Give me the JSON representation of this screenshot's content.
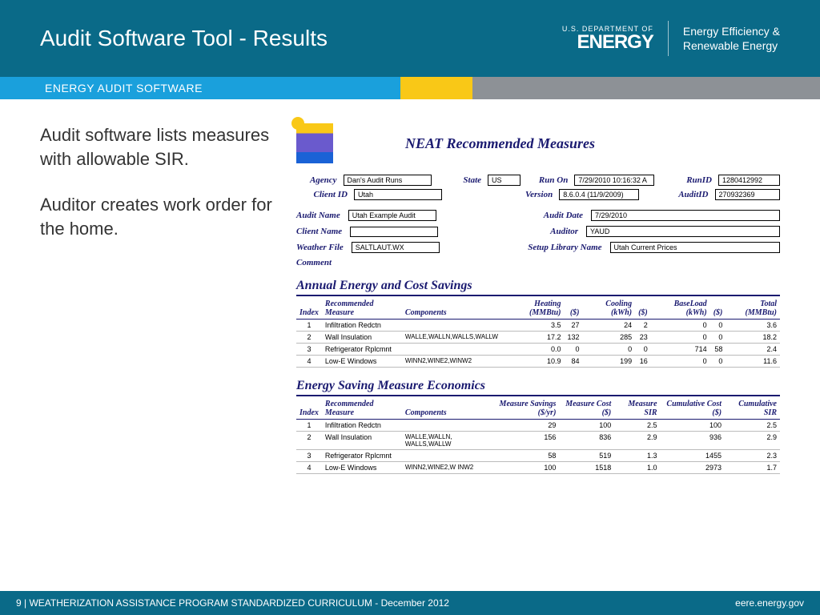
{
  "header": {
    "title": "Audit Software Tool - Results",
    "doe_small": "U.S. DEPARTMENT OF",
    "doe_big": "ENERGY",
    "eere_l1": "Energy Efficiency &",
    "eere_l2": "Renewable Energy"
  },
  "ribbon": {
    "text": "ENERGY AUDIT SOFTWARE"
  },
  "body": {
    "p1": "Audit software lists measures with allowable SIR.",
    "p2": "Auditor creates work order for the home."
  },
  "report": {
    "title": "NEAT Recommended Measures",
    "meta1": {
      "agency": "Dan's Audit Runs",
      "state": "US",
      "run_on": "7/29/2010 10:16:32 A",
      "runid": "1280412992",
      "client_id": "Utah",
      "version": "8.6.0.4 (11/9/2009)",
      "auditid": "270932369",
      "audit_name": "Utah Example Audit",
      "audit_date": "7/29/2010",
      "client_name": "",
      "auditor": "YAUD",
      "weather_file": "SALTLAUT.WX",
      "setup_lib": "Utah Current Prices",
      "comment": ""
    },
    "labels": {
      "agency": "Agency",
      "client_id": "Client ID",
      "state": "State",
      "run_on": "Run On",
      "runid": "RunID",
      "version": "Version",
      "auditid": "AuditID",
      "audit_name": "Audit Name",
      "audit_date": "Audit Date",
      "client_name": "Client Name",
      "auditor": "Auditor",
      "weather_file": "Weather File",
      "setup_lib": "Setup Library Name",
      "comment": "Comment"
    },
    "sec1": {
      "title": "Annual Energy and Cost Savings",
      "head": [
        "Index",
        "Recommended Measure",
        "Components",
        "Heating (MMBtu)",
        "($)",
        "Cooling (kWh)",
        "($)",
        "BaseLoad (kWh)",
        "($)",
        "Total (MMBtu)"
      ],
      "rows": [
        [
          "1",
          "Infiltration Redctn",
          "",
          "3.5",
          "27",
          "24",
          "2",
          "0",
          "0",
          "3.6"
        ],
        [
          "2",
          "Wall Insulation",
          "WALLE,WALLN,WALLS,WALLW",
          "17.2",
          "132",
          "285",
          "23",
          "0",
          "0",
          "18.2"
        ],
        [
          "3",
          "Refrigerator Rplcmnt",
          "",
          "0.0",
          "0",
          "0",
          "0",
          "714",
          "58",
          "2.4"
        ],
        [
          "4",
          "Low-E Windows",
          "WINN2,WINE2,WINW2",
          "10.9",
          "84",
          "199",
          "16",
          "0",
          "0",
          "11.6"
        ]
      ]
    },
    "sec2": {
      "title": "Energy Saving Measure Economics",
      "head": [
        "Index",
        "Recommended Measure",
        "Components",
        "Measure Savings ($/yr)",
        "Measure Cost ($)",
        "Measure SIR",
        "Cumulative Cost ($)",
        "Cumulative SIR"
      ],
      "rows": [
        [
          "1",
          "Infiltration Redctn",
          "",
          "29",
          "100",
          "2.5",
          "100",
          "2.5"
        ],
        [
          "2",
          "Wall Insulation",
          "WALLE,WALLN, WALLS,WALLW",
          "156",
          "836",
          "2.9",
          "936",
          "2.9"
        ],
        [
          "3",
          "Refrigerator Rplcmnt",
          "",
          "58",
          "519",
          "1.3",
          "1455",
          "2.3"
        ],
        [
          "4",
          "Low-E Windows",
          "WINN2,WINE2,W INW2",
          "100",
          "1518",
          "1.0",
          "2973",
          "1.7"
        ]
      ]
    }
  },
  "footer": {
    "left": "9 | WEATHERIZATION ASSISTANCE PROGRAM STANDARDIZED CURRICULUM  - December 2012",
    "right": "eere.energy.gov"
  }
}
